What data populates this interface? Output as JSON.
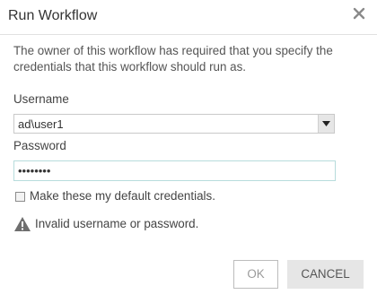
{
  "dialog": {
    "title": "Run Workflow",
    "close_icon": "close-icon",
    "description": "The owner of this workflow has required that you specify the credentials that this workflow should run as."
  },
  "form": {
    "username_label": "Username",
    "username_value": "ad\\user1",
    "username_arrow_icon": "chevron-down-icon",
    "password_label": "Password",
    "password_value": "••••••••",
    "default_credentials_label": "Make these my default credentials.",
    "default_credentials_checked": false
  },
  "error": {
    "icon": "warning-icon",
    "message": "Invalid username or password."
  },
  "buttons": {
    "ok_label": "OK",
    "cancel_label": "CANCEL"
  }
}
